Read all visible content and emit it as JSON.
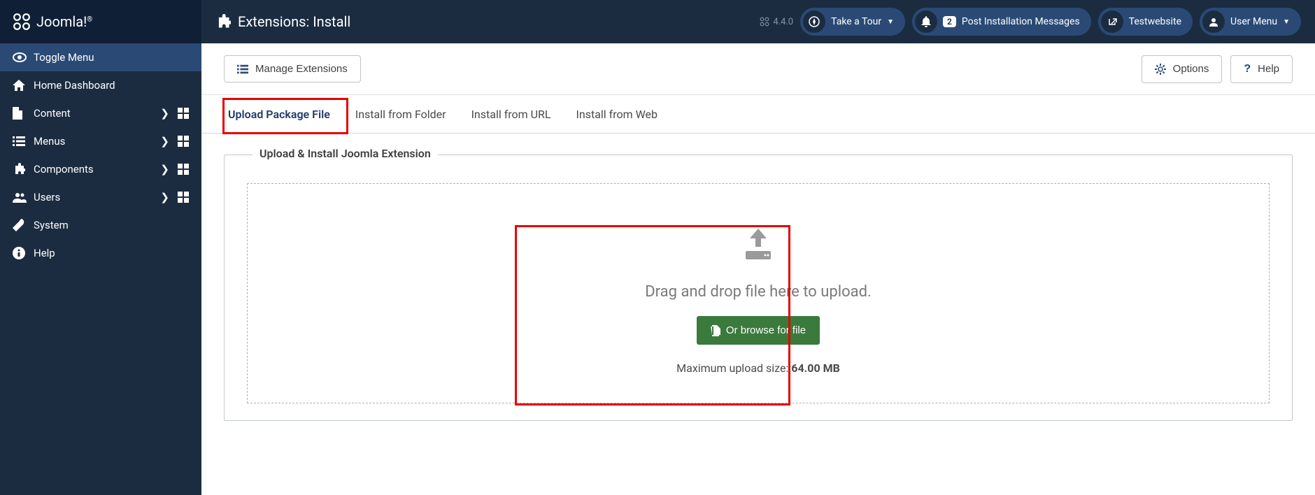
{
  "logo": "Joomla!",
  "header": {
    "title": "Extensions: Install",
    "version": "4.4.0",
    "take_tour": "Take a Tour",
    "notif_count": "2",
    "post_install": "Post Installation Messages",
    "site_name": "Testwebsite",
    "user_menu": "User Menu"
  },
  "sidebar": {
    "toggle": "Toggle Menu",
    "home": "Home Dashboard",
    "content": "Content",
    "menus": "Menus",
    "components": "Components",
    "users": "Users",
    "system": "System",
    "help": "Help"
  },
  "toolbar": {
    "manage": "Manage Extensions",
    "options": "Options",
    "help": "Help"
  },
  "tabs": {
    "upload": "Upload Package File",
    "folder": "Install from Folder",
    "url": "Install from URL",
    "web": "Install from Web"
  },
  "upload": {
    "legend": "Upload & Install Joomla Extension",
    "drop_text": "Drag and drop file here to upload.",
    "browse": "Or browse for file",
    "size_label": "Maximum upload size: ",
    "size_value": "64.00 MB"
  }
}
